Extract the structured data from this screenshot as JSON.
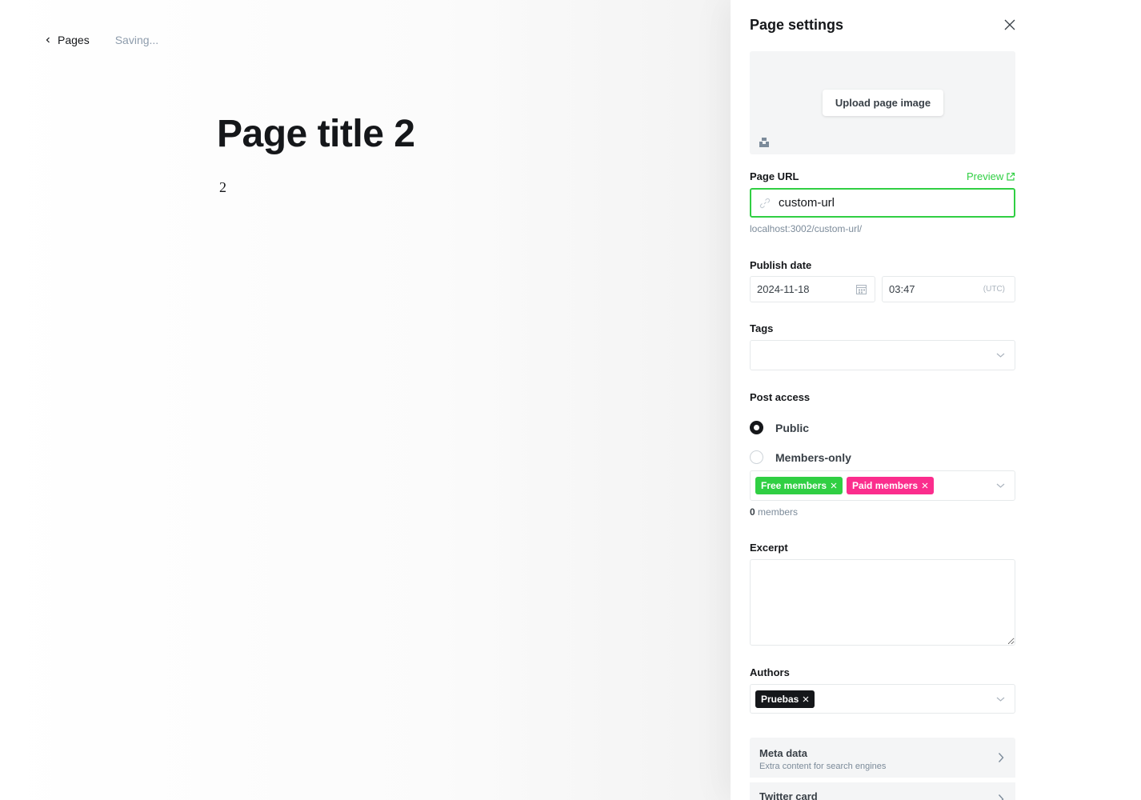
{
  "editor": {
    "back_label": "Pages",
    "save_status": "Saving...",
    "title": "Page title 2",
    "body": "2"
  },
  "settings": {
    "title": "Page settings",
    "upload_label": "Upload page image",
    "url": {
      "label": "Page URL",
      "preview_label": "Preview",
      "value": "custom-url",
      "hint": "localhost:3002/custom-url/"
    },
    "publish": {
      "label": "Publish date",
      "date": "2024-11-18",
      "time": "03:47",
      "timezone": "(UTC)"
    },
    "tags": {
      "label": "Tags"
    },
    "access": {
      "label": "Post access",
      "options": [
        {
          "label": "Public",
          "selected": true
        },
        {
          "label": "Members-only",
          "selected": false
        }
      ],
      "segments": [
        "Free members",
        "Paid members"
      ],
      "count": "0",
      "count_label": "members"
    },
    "excerpt": {
      "label": "Excerpt"
    },
    "authors": {
      "label": "Authors",
      "items": [
        "Pruebas"
      ]
    },
    "nav": [
      {
        "title": "Meta data",
        "subtitle": "Extra content for search engines"
      },
      {
        "title": "Twitter card"
      }
    ]
  },
  "colors": {
    "accent_green": "#30cf43",
    "paid_pink": "#fb2d8d",
    "text_dark": "#15171a",
    "muted": "#7c8b9a"
  }
}
